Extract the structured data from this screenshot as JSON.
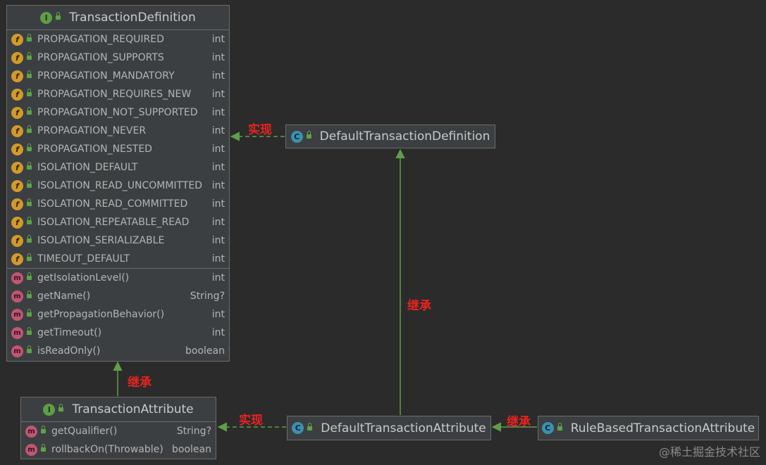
{
  "transaction_definition": {
    "title": "TransactionDefinition",
    "fields": [
      {
        "name": "PROPAGATION_REQUIRED",
        "type": "int"
      },
      {
        "name": "PROPAGATION_SUPPORTS",
        "type": "int"
      },
      {
        "name": "PROPAGATION_MANDATORY",
        "type": "int"
      },
      {
        "name": "PROPAGATION_REQUIRES_NEW",
        "type": "int"
      },
      {
        "name": "PROPAGATION_NOT_SUPPORTED",
        "type": "int"
      },
      {
        "name": "PROPAGATION_NEVER",
        "type": "int"
      },
      {
        "name": "PROPAGATION_NESTED",
        "type": "int"
      },
      {
        "name": "ISOLATION_DEFAULT",
        "type": "int"
      },
      {
        "name": "ISOLATION_READ_UNCOMMITTED",
        "type": "int"
      },
      {
        "name": "ISOLATION_READ_COMMITTED",
        "type": "int"
      },
      {
        "name": "ISOLATION_REPEATABLE_READ",
        "type": "int"
      },
      {
        "name": "ISOLATION_SERIALIZABLE",
        "type": "int"
      },
      {
        "name": "TIMEOUT_DEFAULT",
        "type": "int"
      }
    ],
    "methods": [
      {
        "name": "getIsolationLevel()",
        "type": "int"
      },
      {
        "name": "getName()",
        "type": "String?"
      },
      {
        "name": "getPropagationBehavior()",
        "type": "int"
      },
      {
        "name": "getTimeout()",
        "type": "int"
      },
      {
        "name": "isReadOnly()",
        "type": "boolean"
      }
    ]
  },
  "transaction_attribute": {
    "title": "TransactionAttribute",
    "methods": [
      {
        "name": "getQualifier()",
        "type": "String?"
      },
      {
        "name": "rollbackOn(Throwable)",
        "type": "boolean"
      }
    ]
  },
  "default_transaction_definition": {
    "title": "DefaultTransactionDefinition"
  },
  "default_transaction_attribute": {
    "title": "DefaultTransactionAttribute"
  },
  "rule_based_transaction_attribute": {
    "title": "RuleBasedTransactionAttribute"
  },
  "badges": {
    "interface": "I",
    "class": "C",
    "field": "f",
    "method": "m"
  },
  "relation_labels": {
    "impl_top": "实现",
    "extends_vertical": "继承",
    "extends_left": "继承",
    "impl_bottom": "实现",
    "extends_right": "继承"
  },
  "watermark": "@稀土掘金技术社区",
  "colors": {
    "background": "#2b2b2b",
    "box": "#3c3f41",
    "edge": "#5f9e47",
    "label": "#e8231f"
  }
}
